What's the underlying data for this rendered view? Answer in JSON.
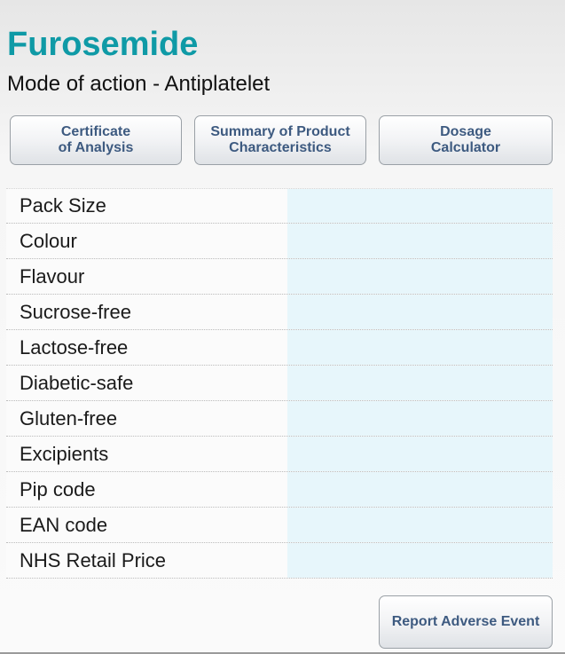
{
  "product": {
    "name": "Furosemide",
    "mode_of_action": "Mode of action - Antiplatelet"
  },
  "colors": {
    "title": "#0f9aa6",
    "button_text": "#3d5a80",
    "value_cell_bg": "#e7f6fb"
  },
  "buttons": {
    "certificate": "Certificate\nof Analysis",
    "spc": "Summary of Product\nCharacteristics",
    "dosage": "Dosage\nCalculator",
    "report": "Report Adverse Event"
  },
  "rows": [
    {
      "label": "Pack Size",
      "value": ""
    },
    {
      "label": "Colour",
      "value": ""
    },
    {
      "label": "Flavour",
      "value": ""
    },
    {
      "label": "Sucrose-free",
      "value": ""
    },
    {
      "label": "Lactose-free",
      "value": ""
    },
    {
      "label": "Diabetic-safe",
      "value": ""
    },
    {
      "label": "Gluten-free",
      "value": ""
    },
    {
      "label": "Excipients",
      "value": ""
    },
    {
      "label": "Pip code",
      "value": ""
    },
    {
      "label": "EAN code",
      "value": ""
    },
    {
      "label": "NHS Retail Price",
      "value": ""
    }
  ]
}
